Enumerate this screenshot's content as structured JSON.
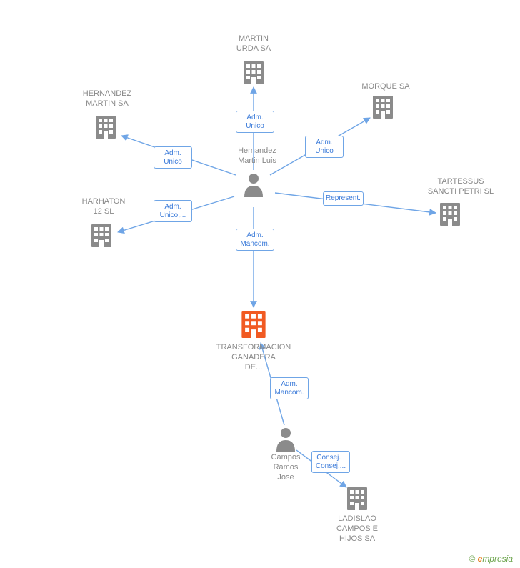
{
  "nodes": {
    "center_person": {
      "label": "Hernandez\nMartin Luis"
    },
    "martin_urda": {
      "label": "MARTIN\nURDA SA"
    },
    "morque": {
      "label": "MORQUE SA"
    },
    "tartessus": {
      "label": "TARTESSUS\nSANCTI PETRI SL"
    },
    "hernandez_m": {
      "label": "HERNANDEZ\nMARTIN SA"
    },
    "harhaton": {
      "label": "HARHATON\n12 SL"
    },
    "transformacion": {
      "label": "TRANSFORMACION\nGANADERA\nDE..."
    },
    "campos": {
      "label": "Campos\nRamos\nJose"
    },
    "ladislao": {
      "label": "LADISLAO\nCAMPOS E\nHIJOS SA"
    }
  },
  "edges": {
    "e_martin_urda": {
      "label": "Adm.\nUnico"
    },
    "e_morque": {
      "label": "Adm.\nUnico"
    },
    "e_tartessus": {
      "label": "Represent."
    },
    "e_hernandez": {
      "label": "Adm.\nUnico"
    },
    "e_harhaton": {
      "label": "Adm.\nUnico,..."
    },
    "e_transf": {
      "label": "Adm.\nMancom."
    },
    "e_campos": {
      "label": "Adm.\nMancom."
    },
    "e_ladislao": {
      "label": "Consej. ,\nConsej...."
    }
  },
  "colors": {
    "building_gray": "#8b8b8b",
    "building_orange": "#f15a22",
    "person_gray": "#8b8b8b",
    "edge_stroke": "#6fa5e6",
    "edge_text": "#3a7ad9",
    "label_gray": "#888888"
  },
  "footer": {
    "copyright_symbol": "©",
    "brand_e": "e",
    "brand_rest": "mpresia"
  }
}
